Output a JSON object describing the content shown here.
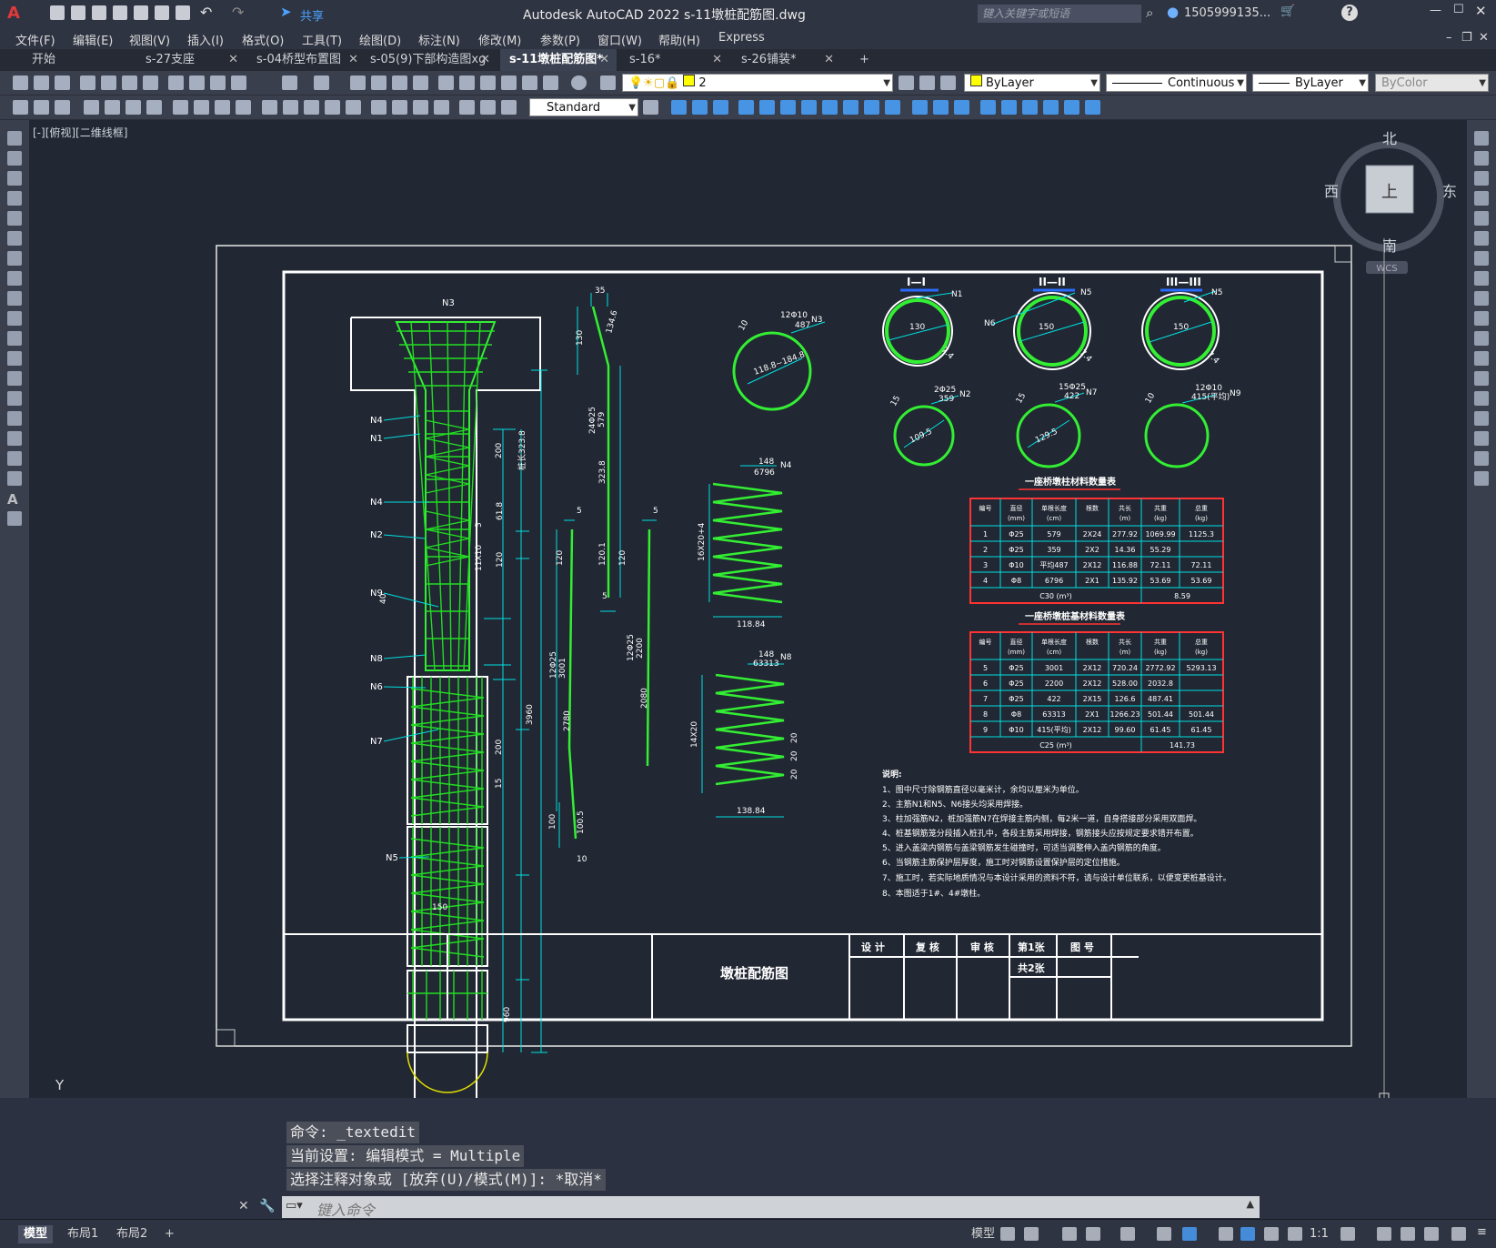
{
  "app": {
    "title": "Autodesk AutoCAD 2022    s-11墩桩配筋图.dwg",
    "share_label": "共享",
    "search_placeholder": "键入关键字或短语",
    "user": "1505999135..."
  },
  "menu": [
    "文件(F)",
    "编辑(E)",
    "视图(V)",
    "插入(I)",
    "格式(O)",
    "工具(T)",
    "绘图(D)",
    "标注(N)",
    "修改(M)",
    "参数(P)",
    "窗口(W)",
    "帮助(H)",
    "Express"
  ],
  "tabs": [
    {
      "label": "开始",
      "closable": false
    },
    {
      "label": "s-27支座",
      "closable": true
    },
    {
      "label": "s-04桥型布置图",
      "closable": true
    },
    {
      "label": "s-05(9)下部构造图xg",
      "closable": true
    },
    {
      "label": "s-11墩桩配筋图*",
      "closable": true,
      "active": true
    },
    {
      "label": "s-16*",
      "closable": true
    },
    {
      "label": "s-26铺装*",
      "closable": true
    }
  ],
  "toolbar": {
    "layer_value": "2",
    "color_value": "ByLayer",
    "linetype_value": "Continuous",
    "lineweight_value": "ByLayer",
    "plotstyle_value": "ByColor",
    "textstyle_value": "Standard"
  },
  "viewport": {
    "label": "[-][俯视][二维线框]",
    "viewcube": {
      "north": "北",
      "south": "南",
      "east": "东",
      "west": "西",
      "face": "上",
      "wcs": "WCS"
    },
    "ucs": {
      "x": "X",
      "y": "Y"
    }
  },
  "drawing": {
    "pier_labels": [
      "N3",
      "N4",
      "N1",
      "N4",
      "N2",
      "N9",
      "N8",
      "N6",
      "N7",
      "N5"
    ],
    "dims_left": [
      "150",
      "960",
      "3960",
      "200",
      "15",
      "40",
      "11X10",
      "120",
      "61.8",
      "200",
      "桩长323.8",
      "5"
    ],
    "bar_dims": [
      "35",
      "130",
      "134.6",
      "24Φ25",
      "579",
      "323.8",
      "120.1",
      "5",
      "120",
      "5",
      "12Φ25",
      "3001",
      "2780",
      "100",
      "100.5",
      "10",
      "5",
      "120",
      "12Φ25",
      "2200",
      "2080"
    ],
    "ring_n3": {
      "label": "12Φ10",
      "sub": "487",
      "n": "N3",
      "dia": "118.8~184.8",
      "lap": "10"
    },
    "spiral_n4": {
      "top": "148",
      "sub": "6796",
      "n": "N4",
      "height": "16X20+4",
      "width": "118.84"
    },
    "spiral_n8": {
      "top": "148",
      "sub": "63313",
      "n": "N8",
      "height": "14X20",
      "width": "138.84",
      "seg": [
        "20",
        "20",
        "20"
      ]
    },
    "sections": [
      {
        "title": "I—I",
        "n": "N1",
        "d": "130",
        "c": "7.4"
      },
      {
        "title": "II—II",
        "n": "N5",
        "n2": "N6",
        "d": "150",
        "c": "7.4"
      },
      {
        "title": "III—III",
        "n": "N5",
        "d": "150",
        "c": "7.4"
      }
    ],
    "rings": [
      {
        "top": "2Φ25",
        "sub": "359",
        "n": "N2",
        "d": "109.5",
        "lap": "15"
      },
      {
        "top": "15Φ25",
        "sub": "422",
        "n": "N7",
        "d": "129.5",
        "lap": "15"
      },
      {
        "top": "12Φ10",
        "sub": "415(平均)",
        "n": "N9",
        "d": "",
        "lap": "10"
      }
    ],
    "table1": {
      "title": "一座桥墩柱材料数量表",
      "headers": [
        "编号",
        "直径(mm)",
        "单根长度(cm)",
        "根数",
        "共长(m)",
        "共重(kg)",
        "总重(kg)"
      ],
      "rows": [
        [
          "1",
          "Φ25",
          "579",
          "2X24",
          "277.92",
          "1069.99",
          "1125.3"
        ],
        [
          "2",
          "Φ25",
          "359",
          "2X2",
          "14.36",
          "55.29",
          ""
        ],
        [
          "3",
          "Φ10",
          "平均487",
          "2X12",
          "116.88",
          "72.11",
          "72.11"
        ],
        [
          "4",
          "Φ8",
          "6796",
          "2X1",
          "135.92",
          "53.69",
          "53.69"
        ]
      ],
      "footer": [
        "C30 (m³)",
        "8.59"
      ]
    },
    "table2": {
      "title": "一座桥墩桩基材料数量表",
      "headers": [
        "编号",
        "直径(mm)",
        "单根长度(cm)",
        "根数",
        "共长(m)",
        "共重(kg)",
        "总重(kg)"
      ],
      "rows": [
        [
          "5",
          "Φ25",
          "3001",
          "2X12",
          "720.24",
          "2772.92",
          "5293.13"
        ],
        [
          "6",
          "Φ25",
          "2200",
          "2X12",
          "528.00",
          "2032.8",
          ""
        ],
        [
          "7",
          "Φ25",
          "422",
          "2X15",
          "126.6",
          "487.41",
          ""
        ],
        [
          "8",
          "Φ8",
          "63313",
          "2X1",
          "1266.23",
          "501.44",
          "501.44"
        ],
        [
          "9",
          "Φ10",
          "415(平均)",
          "2X12",
          "99.60",
          "61.45",
          "61.45"
        ]
      ],
      "footer": [
        "C25 (m³)",
        "141.73"
      ]
    },
    "notes_title": "说明:",
    "notes": [
      "1、图中尺寸除钢筋直径以毫米计，余均以厘米为单位。",
      "2、主筋N1和N5、N6接头均采用焊接。",
      "3、柱加强筋N2，桩加强筋N7在焊接主筋内侧，每2米一道，自身搭接部分采用双面焊。",
      "4、桩基钢筋笼分段插入桩孔中，各段主筋采用焊接，钢筋接头应按规定要求错开布置。",
      "5、进入盖梁内钢筋与盖梁钢筋发生碰撞时，可适当调整伸入盖内钢筋的角度。",
      "6、当钢筋主筋保护层厚度，施工时对钢筋设置保护层的定位措施。",
      "7、施工时，若实际地质情况与本设计采用的资料不符，请与设计单位联系，以便变更桩基设计。",
      "8、本图适于1#、4#墩柱。"
    ],
    "titleblock": {
      "name": "墩桩配筋图",
      "cells": [
        "设 计",
        "复 核",
        "审 核",
        "第1张",
        "图 号",
        "共2张"
      ]
    }
  },
  "command": {
    "history": [
      "命令: _textedit",
      "当前设置: 编辑模式 = Multiple",
      "选择注释对象或 [放弃(U)/模式(M)]: *取消*"
    ],
    "placeholder": "键入命令"
  },
  "status": {
    "layout_tabs": [
      "模型",
      "布局1",
      "布局2"
    ],
    "model_label": "模型",
    "scale": "1:1"
  }
}
